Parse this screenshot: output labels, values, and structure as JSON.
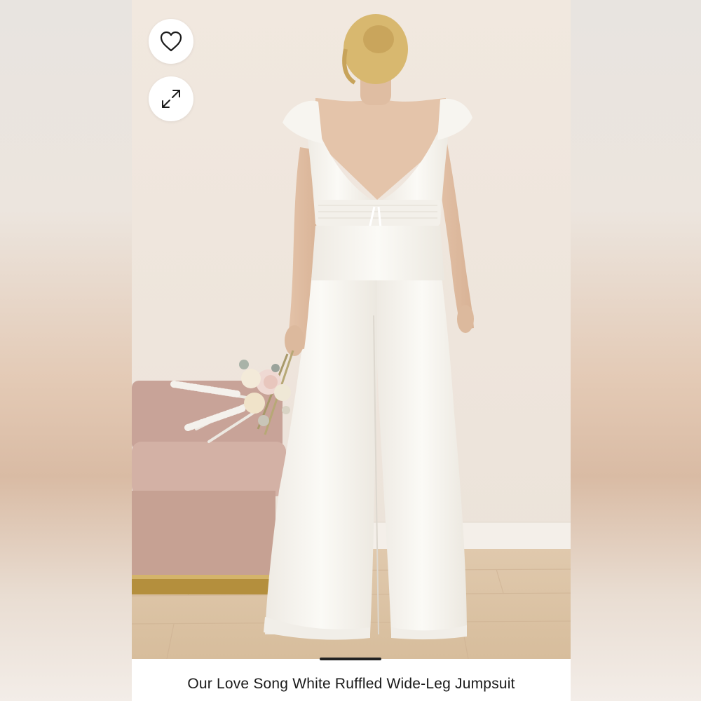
{
  "product": {
    "title": "Our Love Song White Ruffled Wide-Leg Jumpsuit",
    "image_alt": "Model wearing white ruffled wide-leg jumpsuit, back view, holding a bouquet, beside a pink chair"
  },
  "actions": {
    "like_icon": "heart-icon",
    "expand_icon": "expand-icon"
  },
  "gallery": {
    "active_indicator": true
  },
  "colors": {
    "wall": "#efe6dd",
    "floor": "#d9c2a4",
    "jumpsuit": "#f8f6f1",
    "chair": "#c9a79b"
  }
}
